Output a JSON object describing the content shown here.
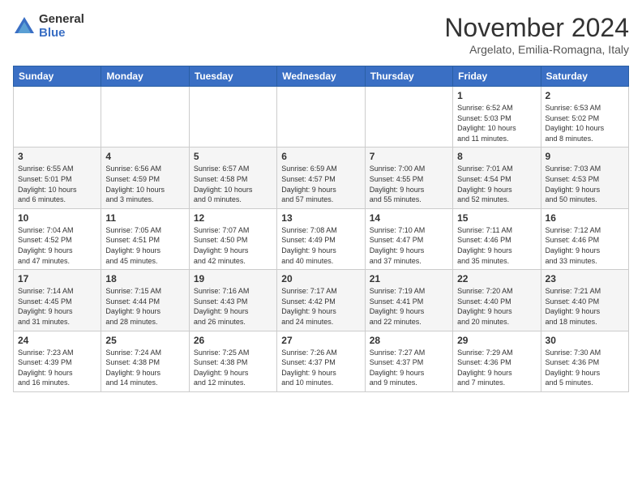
{
  "logo": {
    "general": "General",
    "blue": "Blue"
  },
  "header": {
    "month": "November 2024",
    "location": "Argelato, Emilia-Romagna, Italy"
  },
  "days_header": [
    "Sunday",
    "Monday",
    "Tuesday",
    "Wednesday",
    "Thursday",
    "Friday",
    "Saturday"
  ],
  "weeks": [
    [
      {
        "day": "",
        "info": ""
      },
      {
        "day": "",
        "info": ""
      },
      {
        "day": "",
        "info": ""
      },
      {
        "day": "",
        "info": ""
      },
      {
        "day": "",
        "info": ""
      },
      {
        "day": "1",
        "info": "Sunrise: 6:52 AM\nSunset: 5:03 PM\nDaylight: 10 hours\nand 11 minutes."
      },
      {
        "day": "2",
        "info": "Sunrise: 6:53 AM\nSunset: 5:02 PM\nDaylight: 10 hours\nand 8 minutes."
      }
    ],
    [
      {
        "day": "3",
        "info": "Sunrise: 6:55 AM\nSunset: 5:01 PM\nDaylight: 10 hours\nand 6 minutes."
      },
      {
        "day": "4",
        "info": "Sunrise: 6:56 AM\nSunset: 4:59 PM\nDaylight: 10 hours\nand 3 minutes."
      },
      {
        "day": "5",
        "info": "Sunrise: 6:57 AM\nSunset: 4:58 PM\nDaylight: 10 hours\nand 0 minutes."
      },
      {
        "day": "6",
        "info": "Sunrise: 6:59 AM\nSunset: 4:57 PM\nDaylight: 9 hours\nand 57 minutes."
      },
      {
        "day": "7",
        "info": "Sunrise: 7:00 AM\nSunset: 4:55 PM\nDaylight: 9 hours\nand 55 minutes."
      },
      {
        "day": "8",
        "info": "Sunrise: 7:01 AM\nSunset: 4:54 PM\nDaylight: 9 hours\nand 52 minutes."
      },
      {
        "day": "9",
        "info": "Sunrise: 7:03 AM\nSunset: 4:53 PM\nDaylight: 9 hours\nand 50 minutes."
      }
    ],
    [
      {
        "day": "10",
        "info": "Sunrise: 7:04 AM\nSunset: 4:52 PM\nDaylight: 9 hours\nand 47 minutes."
      },
      {
        "day": "11",
        "info": "Sunrise: 7:05 AM\nSunset: 4:51 PM\nDaylight: 9 hours\nand 45 minutes."
      },
      {
        "day": "12",
        "info": "Sunrise: 7:07 AM\nSunset: 4:50 PM\nDaylight: 9 hours\nand 42 minutes."
      },
      {
        "day": "13",
        "info": "Sunrise: 7:08 AM\nSunset: 4:49 PM\nDaylight: 9 hours\nand 40 minutes."
      },
      {
        "day": "14",
        "info": "Sunrise: 7:10 AM\nSunset: 4:47 PM\nDaylight: 9 hours\nand 37 minutes."
      },
      {
        "day": "15",
        "info": "Sunrise: 7:11 AM\nSunset: 4:46 PM\nDaylight: 9 hours\nand 35 minutes."
      },
      {
        "day": "16",
        "info": "Sunrise: 7:12 AM\nSunset: 4:46 PM\nDaylight: 9 hours\nand 33 minutes."
      }
    ],
    [
      {
        "day": "17",
        "info": "Sunrise: 7:14 AM\nSunset: 4:45 PM\nDaylight: 9 hours\nand 31 minutes."
      },
      {
        "day": "18",
        "info": "Sunrise: 7:15 AM\nSunset: 4:44 PM\nDaylight: 9 hours\nand 28 minutes."
      },
      {
        "day": "19",
        "info": "Sunrise: 7:16 AM\nSunset: 4:43 PM\nDaylight: 9 hours\nand 26 minutes."
      },
      {
        "day": "20",
        "info": "Sunrise: 7:17 AM\nSunset: 4:42 PM\nDaylight: 9 hours\nand 24 minutes."
      },
      {
        "day": "21",
        "info": "Sunrise: 7:19 AM\nSunset: 4:41 PM\nDaylight: 9 hours\nand 22 minutes."
      },
      {
        "day": "22",
        "info": "Sunrise: 7:20 AM\nSunset: 4:40 PM\nDaylight: 9 hours\nand 20 minutes."
      },
      {
        "day": "23",
        "info": "Sunrise: 7:21 AM\nSunset: 4:40 PM\nDaylight: 9 hours\nand 18 minutes."
      }
    ],
    [
      {
        "day": "24",
        "info": "Sunrise: 7:23 AM\nSunset: 4:39 PM\nDaylight: 9 hours\nand 16 minutes."
      },
      {
        "day": "25",
        "info": "Sunrise: 7:24 AM\nSunset: 4:38 PM\nDaylight: 9 hours\nand 14 minutes."
      },
      {
        "day": "26",
        "info": "Sunrise: 7:25 AM\nSunset: 4:38 PM\nDaylight: 9 hours\nand 12 minutes."
      },
      {
        "day": "27",
        "info": "Sunrise: 7:26 AM\nSunset: 4:37 PM\nDaylight: 9 hours\nand 10 minutes."
      },
      {
        "day": "28",
        "info": "Sunrise: 7:27 AM\nSunset: 4:37 PM\nDaylight: 9 hours\nand 9 minutes."
      },
      {
        "day": "29",
        "info": "Sunrise: 7:29 AM\nSunset: 4:36 PM\nDaylight: 9 hours\nand 7 minutes."
      },
      {
        "day": "30",
        "info": "Sunrise: 7:30 AM\nSunset: 4:36 PM\nDaylight: 9 hours\nand 5 minutes."
      }
    ]
  ]
}
